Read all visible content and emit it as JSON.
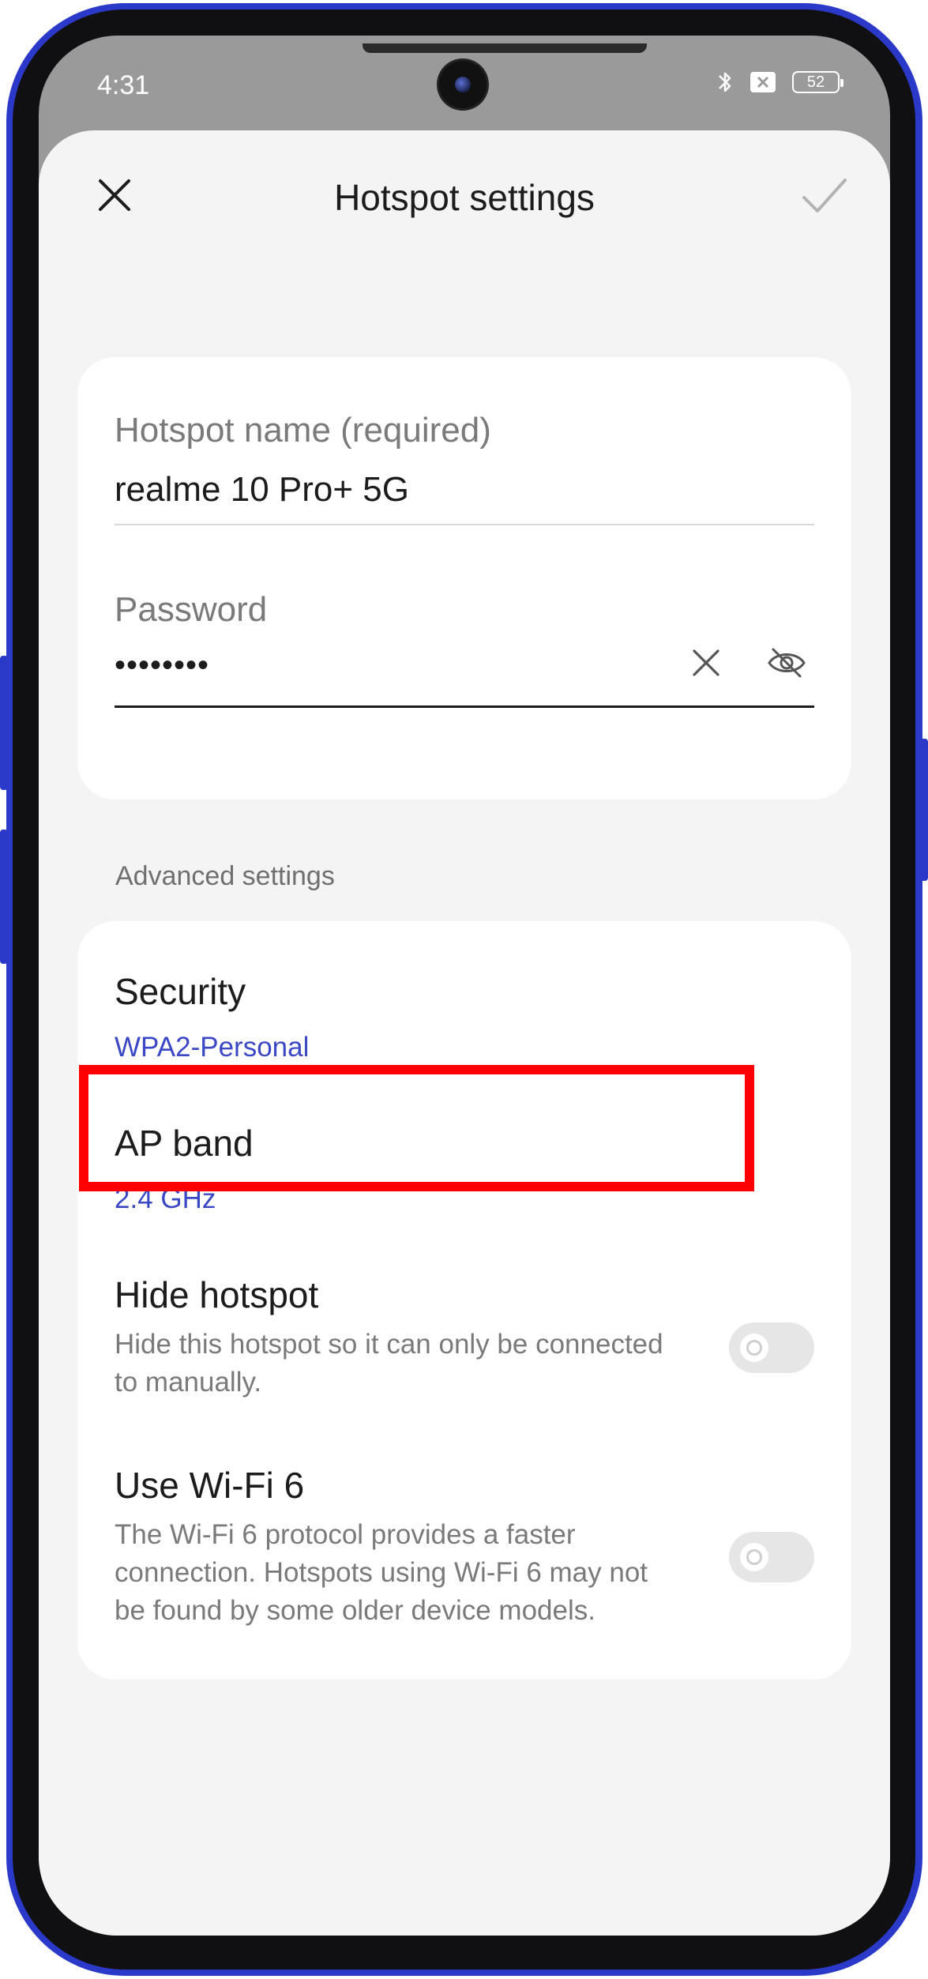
{
  "status_bar": {
    "time": "4:31",
    "battery": "52",
    "icons": [
      "bluetooth-icon",
      "x-box-icon",
      "battery-icon"
    ]
  },
  "topbar": {
    "title": "Hotspot settings",
    "close_icon": "close-icon",
    "confirm_icon": "check-icon"
  },
  "hotspot": {
    "name_label": "Hotspot name (required)",
    "name_value": "realme 10 Pro+ 5G",
    "password_label": "Password",
    "password_value": "••••••••",
    "clear_icon": "clear-icon",
    "visibility_icon": "eye-off-icon"
  },
  "advanced": {
    "header": "Advanced settings",
    "security": {
      "title": "Security",
      "value": "WPA2-Personal"
    },
    "ap_band": {
      "title": "AP band",
      "value": "2.4 GHz"
    },
    "hide_hotspot": {
      "title": "Hide hotspot",
      "description": "Hide this hotspot so it can only be connected to manually.",
      "enabled": false
    },
    "wifi6": {
      "title": "Use Wi-Fi 6",
      "description": "The Wi-Fi 6 protocol provides a faster connection. Hotspots using Wi-Fi 6 may not be found by some older device models.",
      "enabled": false
    }
  },
  "colors": {
    "frame": "#2b39c9",
    "accent_text": "#3b48c6",
    "highlight": "#ff0000",
    "sheet_bg": "#f4f4f4"
  }
}
